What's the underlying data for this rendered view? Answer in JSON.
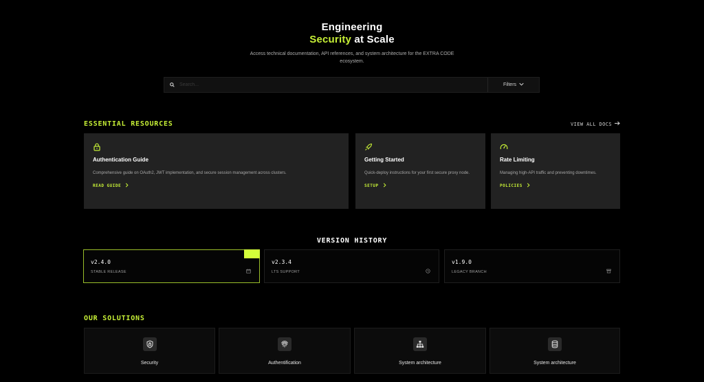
{
  "hero": {
    "title_line1": "Engineering",
    "title_accent": "Security",
    "title_rest": " at Scale",
    "subtitle": "Access technical documentation, API references, and system architecture for the EXTRA CODE ecosystem."
  },
  "search": {
    "placeholder": "Search...",
    "filters_label": "Filters"
  },
  "resources": {
    "section_title": "ESSENTIAL RESOURCES",
    "view_all_label": "VIEW ALL DOCS",
    "cards": [
      {
        "icon": "lock-icon",
        "title": "Authentication Guide",
        "description": "Comprehensive guide on OAuth2, JWT implementation, and secure session management across clusters.",
        "link": "READ GUIDE"
      },
      {
        "icon": "rocket-icon",
        "title": "Getting Started",
        "description": "Quick-deploy instructions for your first secure proxy node.",
        "link": "SETUP"
      },
      {
        "icon": "gauge-icon",
        "title": "Rate Limiting",
        "description": "Managing high-API traffic and preventing downtimes.",
        "link": "POLICIES"
      }
    ]
  },
  "versions": {
    "section_title": "VERSION HISTORY",
    "items": [
      {
        "version": "v2.4.0",
        "label": "STABLE RELEASE",
        "icon": "calendar-icon",
        "active": true
      },
      {
        "version": "v2.3.4",
        "label": "LTS SUPPORT",
        "icon": "clock-icon",
        "active": false
      },
      {
        "version": "v1.9.0",
        "label": "LEGACY BRANCH",
        "icon": "archive-icon",
        "active": false
      }
    ]
  },
  "solutions": {
    "section_title": "OUR SOLUTIONS",
    "items": [
      {
        "label": "Security",
        "icon": "shield-icon"
      },
      {
        "label": "Authentification",
        "icon": "fingerprint-icon"
      },
      {
        "label": "System architecture",
        "icon": "network-icon"
      },
      {
        "label": "System architecture",
        "icon": "database-icon"
      }
    ]
  },
  "colors": {
    "background": "#000000",
    "accent": "#c6ef36",
    "card": "#222222",
    "badge": "#d4ff3a"
  }
}
